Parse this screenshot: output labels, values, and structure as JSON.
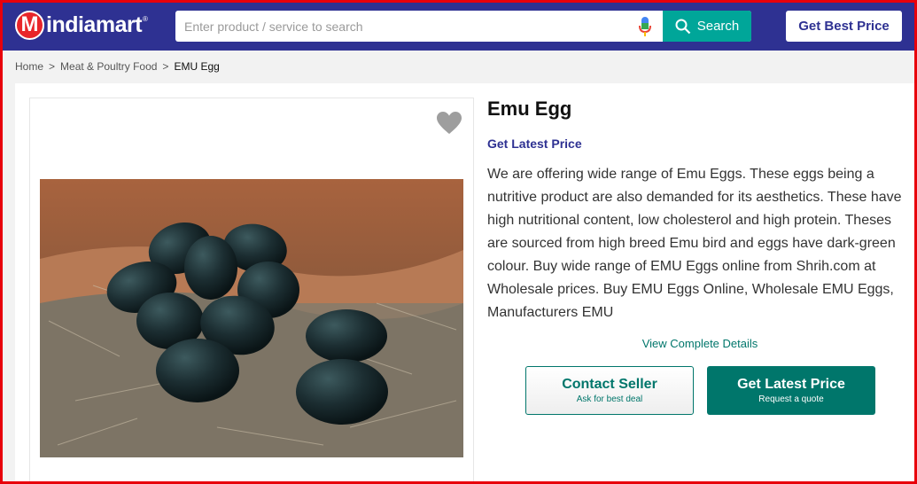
{
  "header": {
    "logo_letter": "M",
    "logo_text": "indiamart",
    "logo_reg": "®",
    "search_placeholder": "Enter product / service to search",
    "search_button": "Search",
    "best_price_button": "Get Best Price"
  },
  "breadcrumb": {
    "items": [
      "Home",
      "Meat & Poultry Food",
      "EMU Egg"
    ],
    "separator": ">"
  },
  "product": {
    "title": "Emu Egg",
    "get_latest_price_link": "Get Latest Price",
    "description": "We are offering wide range of Emu Eggs. These eggs being a nutritive product are also demanded for its aesthetics. These have high nutritional content, low cholesterol and high protein. Theses are sourced from high breed Emu bird and eggs have dark-green colour. Buy wide range of EMU Eggs online from Shrih.com at Wholesale prices. Buy EMU Eggs Online, Wholesale EMU Eggs, Manufacturers EMU",
    "view_details_link": "View Complete Details"
  },
  "actions": {
    "contact_seller": "Contact Seller",
    "contact_seller_sub": "Ask for best deal",
    "get_latest_price": "Get Latest Price",
    "get_latest_price_sub": "Request a quote"
  },
  "colors": {
    "header_bg": "#2e3192",
    "accent_teal": "#00a699",
    "button_teal": "#00766b",
    "frame_red": "#e8000b"
  }
}
